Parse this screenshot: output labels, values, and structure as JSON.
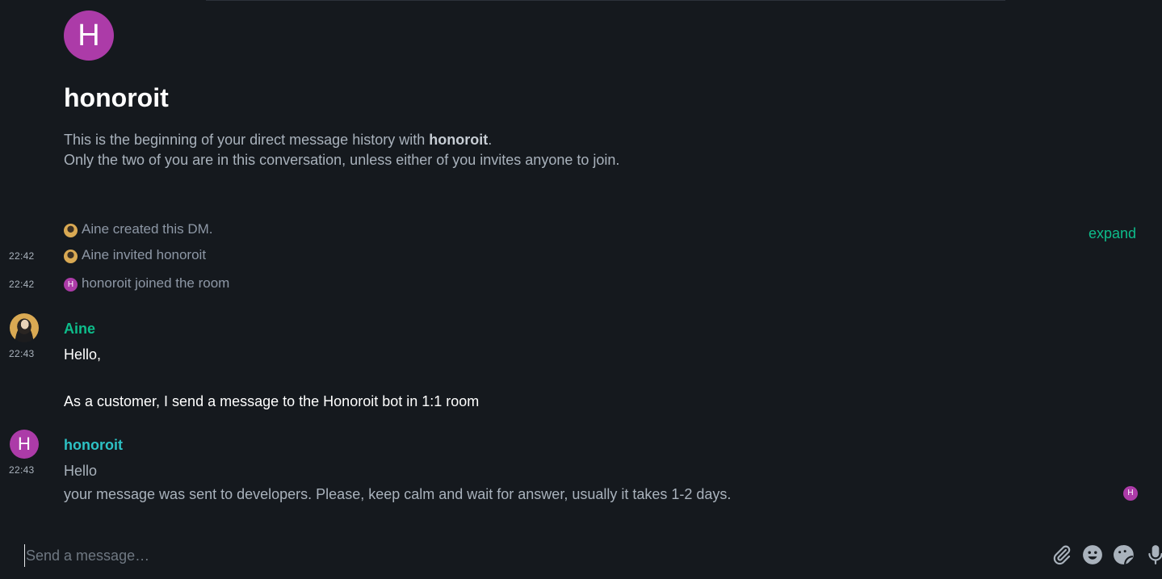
{
  "room": {
    "avatar_letter": "H",
    "name": "honoroit",
    "intro_prefix": "This is the beginning of your direct message history with ",
    "intro_name": "honoroit",
    "intro_suffix": ".",
    "intro_line2": "Only the two of you are in this conversation, unless either of you invites anyone to join."
  },
  "events": [
    {
      "time": "",
      "text": "Aine created this DM."
    },
    {
      "time": "22:42",
      "text": "Aine invited honoroit"
    },
    {
      "time": "22:42",
      "text": "honoroit joined the room",
      "avatar_letter": "H"
    }
  ],
  "expand_label": "expand",
  "messages": [
    {
      "sender": "Aine",
      "time": "22:43",
      "lines": [
        "Hello,",
        "As a customer, I send a message to the Honoroit bot in 1:1 room"
      ]
    },
    {
      "sender": "honoroit",
      "avatar_letter": "H",
      "time": "22:43",
      "lines": [
        "Hello",
        "your message was sent to developers. Please, keep calm and wait for answer, usually it takes 1-2 days."
      ]
    }
  ],
  "read_receipt_letter": "H",
  "composer": {
    "placeholder": "Send a message…"
  },
  "colors": {
    "background": "#15191e",
    "accent": "#0dbd8b",
    "avatar_purple": "#ac3ba8",
    "honoroit_name": "#2dc2c5"
  }
}
